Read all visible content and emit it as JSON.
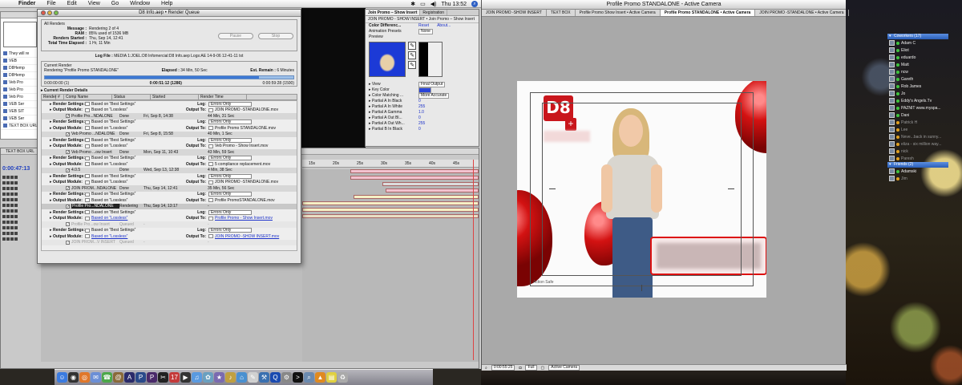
{
  "menubar": {
    "app": "Finder",
    "items": [
      "File",
      "Edit",
      "View",
      "Go",
      "Window",
      "Help"
    ],
    "clock": "Thu 13:52"
  },
  "finder": {
    "rows": [
      "They will re",
      "VEB",
      "D8Hemp",
      "D8Hemp",
      "Veb Pro",
      "Veb Pro",
      "Veb Pro",
      "VEB Ser",
      "VEB SIT",
      "VEB Ser",
      "TEXT BOX URL"
    ]
  },
  "render_queue": {
    "title": "D8 Info.aep • Render Queue",
    "all_renders": "All Renders",
    "message_label": "Message :",
    "message": "Rendering 2 of 4",
    "ram_label": "RAM :",
    "ram": "85% used of 1536 MB",
    "started_label": "Renders Started :",
    "started": "Thu, Sep 14, 12:41",
    "elapsed_label": "Total Time Elapsed :",
    "elapsed": "1 Hr, 11 Min",
    "pause": "Pause",
    "stop": "Stop",
    "log_label": "Log File :",
    "log": "MEDIA 1:JOEL:D8 Infomercial:D8 Info.aep Logs:AE 14-9-06 12-41-11 txt",
    "current_render": "Current Render",
    "rendering_label": "Rendering “Profile Promo STANDALONE”",
    "elapsed_cur_label": "Elapsed :",
    "elapsed_cur": "34 Min, 50 Sec",
    "remain_label": "Est. Remain :",
    "remain": "6 Minutes",
    "progress": 0.86,
    "tc_start": "0:00:00:00 (1)",
    "tc_current": "0:00:51:12 (1286)",
    "tc_end": "0:00:59:28 (1500)",
    "details": "Current Render Details",
    "columns": [
      "Render",
      "#",
      "Comp Name",
      "Status",
      "Started",
      "Render Time"
    ],
    "items": [
      {
        "name": "Profile Pro...NDALONE",
        "status": "Done",
        "started": "Fri, Sep 8, 14:38",
        "time": "44 Min, 31 Sec",
        "output": "JOIN PROMO -STANDALONE.mov",
        "checked": true,
        "settings": "Best Settings",
        "module": "Lossless",
        "log": "Errors Only",
        "dim": false,
        "link": false
      },
      {
        "name": "Veb Promo ...NDALONE",
        "status": "Done",
        "started": "Fri, Sep 8, 15:58",
        "time": "40 Min, 1 Sec",
        "output": "Profile Promo STANDALONE.mov",
        "checked": true,
        "settings": "Best Settings",
        "module": "Lossless",
        "log": "Errors Only",
        "dim": false,
        "link": false
      },
      {
        "name": "Veb Promo ...ow Insert",
        "status": "Done",
        "started": "Mon, Sep 11, 10:43",
        "time": "43 Min, 59 Sec",
        "output": "Veb Promo - Show Insert.mov",
        "checked": true,
        "settings": "Best Settings",
        "module": "Lossless",
        "log": "Errors Only",
        "dim": false,
        "link": false
      },
      {
        "name": "4.0.5",
        "status": "Done",
        "started": "Wed, Sep 13, 12:38",
        "time": "4 Min, 38 Sec",
        "output": "5 compliance replacement.mov",
        "checked": true,
        "settings": "Best Settings",
        "module": "Lossless",
        "log": "Errors Only",
        "dim": false,
        "link": false
      },
      {
        "name": "JOIN PROM...NDALONE",
        "status": "Done",
        "started": "Thu, Sep 14, 12:41",
        "time": "35 Min, 56 Sec",
        "output": "JOIN PROMO -STANDALONE.mov",
        "checked": true,
        "settings": "Best Settings",
        "module": "Lossless",
        "log": "Errors Only",
        "dim": false,
        "link": false
      },
      {
        "name": "Profile Pro...NDALONE",
        "status": "Rendering",
        "started": "Thu, Sep 14, 13:17",
        "time": "-",
        "output": "Profile PromoSTANDALONE.mov",
        "checked": true,
        "settings": "Best Settings",
        "module": "Lossless",
        "log": "Errors Only",
        "dim": false,
        "link": false,
        "selected": true
      },
      {
        "name": "Profile Pro...ow Insert",
        "status": "Queued",
        "started": "-",
        "time": "-",
        "output": "Profile Promo - Show Insert.mov",
        "checked": true,
        "settings": "Best Settings",
        "module": "Lossless",
        "log": "Errors Only",
        "dim": true,
        "link": true
      },
      {
        "name": "JOIN PROM...V INSERT",
        "status": "Queued",
        "started": "-",
        "time": "-",
        "output": "JOIN PROMO -SHOW INSERT.mov",
        "checked": true,
        "settings": "Best Settings",
        "module": "Lossless",
        "log": "Errors Only",
        "dim": true,
        "link": true
      }
    ],
    "labels": {
      "render_settings": "Render Settings:",
      "output_module": "Output Module:",
      "based_on": "Based on",
      "log": "Log:",
      "output_to": "Output To:"
    }
  },
  "timeline": {
    "tabs": [
      "TEXT BOX URL"
    ],
    "timecode": "0:00:47:13",
    "ruler": [
      "15s",
      "20s",
      "25s",
      "30s",
      "35s",
      "40s",
      "45s"
    ],
    "bar_tabs": [
      "JOIN PROMO -STANDALONE",
      "JOIN PROMO -STANDALONE"
    ]
  },
  "effect_controls": {
    "tabs": [
      "Join Promo – Show Insert",
      "Registration"
    ],
    "sub1": "JOIN PROMO - SHOW INSERT • Join Promo – Show Insert",
    "effect": "Color Differenc...",
    "effect_reset": "Reset",
    "effect_about": "About...",
    "presets_label": "Animation Presets",
    "presets_value": "None",
    "preview": "Preview",
    "rows": [
      {
        "k": "View",
        "v": "Final Output"
      },
      {
        "k": "Key Color",
        "v": ""
      },
      {
        "k": "Color Matching ...",
        "v": "More Accurate"
      },
      {
        "k": "Partial A In Black",
        "v": "0"
      },
      {
        "k": "Partial A In White",
        "v": "255"
      },
      {
        "k": "Partial A Gamma",
        "v": "1.0"
      },
      {
        "k": "Partial A Out Bl...",
        "v": "0"
      },
      {
        "k": "Partial A Out Wh...",
        "v": "255"
      },
      {
        "k": "Partial B In Black",
        "v": "0"
      }
    ]
  },
  "composition": {
    "window_title": "Profile Promo STANDALONE - Active Camera",
    "tabs": [
      {
        "label": "JOIN PROMO -SHOW INSERT",
        "active": false
      },
      {
        "label": "TEXT BOX",
        "active": false
      },
      {
        "label": "Profile Promo Show Insert • Active Camera",
        "active": false
      },
      {
        "label": "Profile Promo STANDALONE • Active Camera",
        "active": true
      },
      {
        "label": "JOIN PROMO -STANDALONE • Active Camera",
        "active": false
      }
    ],
    "logo_text": "D8",
    "logo_sub": "+",
    "action_safe": "Action Safe",
    "footer": {
      "timecode": "0:00:55:25",
      "res": "Full",
      "camera": "Active Camera"
    }
  },
  "buddy_list": {
    "groups": [
      {
        "name": "Coworkers (17)",
        "buddies": [
          {
            "name": "Adam C",
            "idle": false
          },
          {
            "name": "Eliot",
            "idle": false
          },
          {
            "name": "eduardo",
            "idle": false
          },
          {
            "name": "Matt",
            "idle": false
          },
          {
            "name": "ncw",
            "idle": false
          },
          {
            "name": "Gareth",
            "idle": false
          },
          {
            "name": "Rob James",
            "idle": false
          },
          {
            "name": "Jo",
            "idle": false
          },
          {
            "name": "Eddy's Angels.Tv",
            "idle": false
          },
          {
            "name": "PAZNIT www.myspa...",
            "idle": false
          },
          {
            "name": "Dani",
            "idle": false
          },
          {
            "name": "Patrick H",
            "idle": true
          },
          {
            "name": "Lee",
            "idle": true
          },
          {
            "name": "Neve...back in sunny...",
            "idle": true
          },
          {
            "name": "eliza - six million way...",
            "idle": true
          },
          {
            "name": "nick",
            "idle": true
          },
          {
            "name": "Paresh",
            "idle": true
          }
        ]
      },
      {
        "name": "Friends (2)",
        "buddies": [
          {
            "name": "Adamski",
            "idle": false
          },
          {
            "name": "Jim",
            "idle": true
          }
        ]
      }
    ]
  },
  "dock": {
    "icons": [
      {
        "name": "finder-icon",
        "color": "#3b7be0",
        "glyph": "☺"
      },
      {
        "name": "dashboard-icon",
        "color": "#333333",
        "glyph": "◉"
      },
      {
        "name": "firefox-icon",
        "color": "#e0772a",
        "glyph": "◎"
      },
      {
        "name": "mail-icon",
        "color": "#6b8fd6",
        "glyph": "✉"
      },
      {
        "name": "ichat-icon",
        "color": "#4da84a",
        "glyph": "☎"
      },
      {
        "name": "address-book-icon",
        "color": "#8a6a3a",
        "glyph": "@"
      },
      {
        "name": "ae-icon",
        "color": "#2b2b6a",
        "glyph": "A"
      },
      {
        "name": "photoshop-icon",
        "color": "#2a4a8a",
        "glyph": "P"
      },
      {
        "name": "premiere-icon",
        "color": "#4a2a6a",
        "glyph": "P"
      },
      {
        "name": "final-cut-icon",
        "color": "#222222",
        "glyph": "✂"
      },
      {
        "name": "ical-icon",
        "color": "#c43a3a",
        "glyph": "17"
      },
      {
        "name": "dvd-icon",
        "color": "#333333",
        "glyph": "▶"
      },
      {
        "name": "itunes-icon",
        "color": "#5a9ae0",
        "glyph": "♫"
      },
      {
        "name": "iphoto-icon",
        "color": "#6aa0c0",
        "glyph": "✿"
      },
      {
        "name": "imovie-icon",
        "color": "#7a6ab0",
        "glyph": "★"
      },
      {
        "name": "garageband-icon",
        "color": "#c0a040",
        "glyph": "♪"
      },
      {
        "name": "safari-icon",
        "color": "#4a90d0",
        "glyph": "⌂"
      },
      {
        "name": "textedit-icon",
        "color": "#d0d0d0",
        "glyph": "✎"
      },
      {
        "name": "xcode-icon",
        "color": "#3a70b0",
        "glyph": "⚒"
      },
      {
        "name": "quicktime-icon",
        "color": "#1a4ab0",
        "glyph": "Q"
      },
      {
        "name": "system-prefs-icon",
        "color": "#888888",
        "glyph": "⚙"
      },
      {
        "name": "terminal-icon",
        "color": "#111111",
        "glyph": ">"
      },
      {
        "name": "preview-icon",
        "color": "#6a8ab0",
        "glyph": "⌕"
      },
      {
        "name": "vlc-icon",
        "color": "#e08a20",
        "glyph": "▲"
      },
      {
        "name": "stickies-icon",
        "color": "#e0d040",
        "glyph": "▤"
      },
      {
        "name": "trash-icon",
        "color": "#aaaaaa",
        "glyph": "♻"
      }
    ]
  }
}
